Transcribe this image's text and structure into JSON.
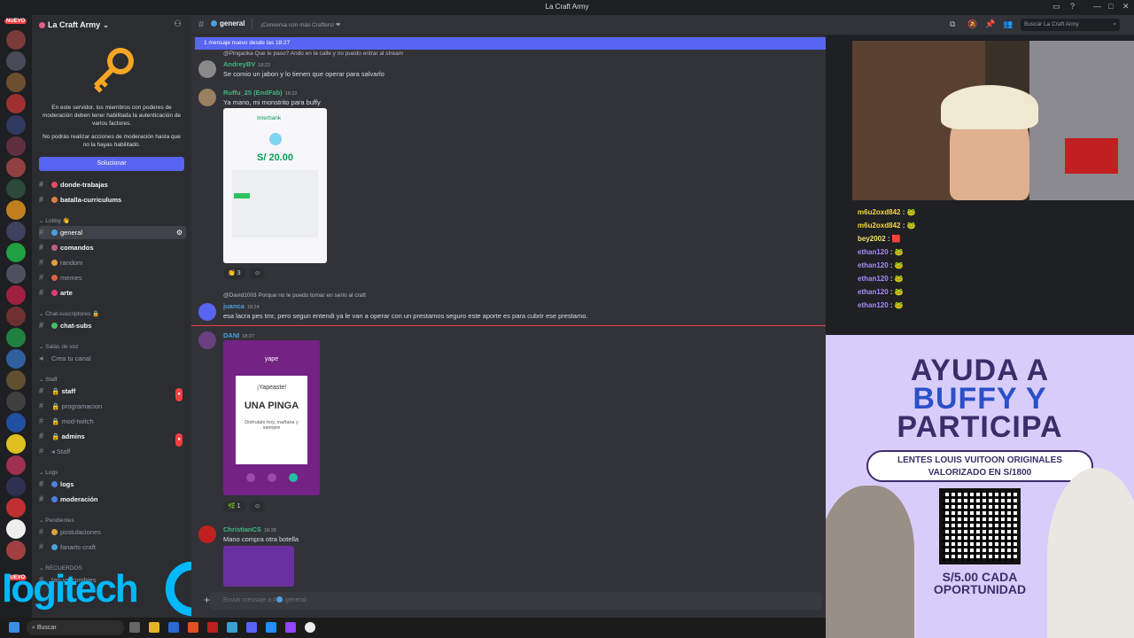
{
  "window": {
    "title": "La Craft Army"
  },
  "server": {
    "name": "La Craft Army"
  },
  "notice": {
    "line1": "En este servidor, los miembros con poderes de moderación deben tener habilitada la autenticación de varios factores.",
    "line2": "No podrás realizar acciones de moderación hasta que no la hayas habilitado.",
    "button": "Solucionar"
  },
  "server_badges": {
    "nuevo_top": "NUEVO",
    "nuevo_bottom": "NUEVO"
  },
  "channels": {
    "top": [
      {
        "name": "donde-trabajas"
      },
      {
        "name": "batalla-curriculums"
      }
    ],
    "lobby_label": "Lobby",
    "lobby": [
      {
        "name": "general"
      },
      {
        "name": "comandos"
      },
      {
        "name": "random"
      },
      {
        "name": "memes"
      },
      {
        "name": "arte"
      }
    ],
    "subs_label": "Chat-suscriptores",
    "subs": [
      {
        "name": "chat-subs"
      }
    ],
    "voice_label": "Salas de voz",
    "voice": [
      {
        "name": "Crea tu canal"
      }
    ],
    "staff_label": "Staff",
    "staff": [
      {
        "name": "staff"
      },
      {
        "name": "programacion"
      },
      {
        "name": "mod-twitch"
      },
      {
        "name": "admins"
      },
      {
        "name": "Staff"
      }
    ],
    "logs_label": "Logs",
    "logs": [
      {
        "name": "logs"
      },
      {
        "name": "moderación"
      }
    ],
    "pend_label": "Pendientes",
    "pend": [
      {
        "name": "postulaciones"
      },
      {
        "name": "fanarts-craft"
      }
    ],
    "rec_label": "RECUERDOS",
    "rec": [
      {
        "name": "tas-vs-zombies"
      }
    ]
  },
  "header": {
    "channel": "general",
    "topic": "¡Conversa con más Crafters! ❤",
    "search_placeholder": "Buscar La Craft Army"
  },
  "new_messages_bar": "1 mensaje nuevo desde las 18:27",
  "messages": [
    {
      "reply": "@Pingaoka Que le paso? Ando en la calle y no puedo entrar al stream"
    },
    {
      "user": "AndreyBV",
      "time": "18:22",
      "text": "Se comio un jabon y lo tienen que operar para salvarlo"
    },
    {
      "user": "Ruffu_25 (EndFab)",
      "time": "18:22",
      "text": "Ya mano, mi monstrito para buffy",
      "reaction": "3"
    },
    {
      "reply": "@David1003 Porque no le puedo tomar en serio al craft"
    },
    {
      "user": "juanca",
      "time": "18:24",
      "text": "esa lacra pes tmr, pero segun entendi ya le van a operar con un prestamos seguro este aporte es para cubrir ese prestamo."
    },
    {
      "user": "DANI",
      "time": "18:27",
      "reaction": "1"
    },
    {
      "user": "ChristianCS",
      "time": "18:28",
      "text": "Mano compra otra botella"
    }
  ],
  "interbank": {
    "brand": "Interbank",
    "amount": "S/ 20.00"
  },
  "yape": {
    "brand": "yape",
    "title": "¡Yapeaste!",
    "name": "UNA PINGA",
    "sub": "Disfrutalo hoy, mañana y siempre"
  },
  "composer": {
    "placeholder": "Enviar mensaje a #",
    "channel": "general"
  },
  "chat": [
    {
      "user": "m6u2oxd842",
      "color": "#f5d742"
    },
    {
      "user": "m6u2oxd842",
      "color": "#f5d742"
    },
    {
      "user": "bey2002",
      "color": "#f5e66b"
    },
    {
      "user": "ethan120",
      "color": "#a78bfa"
    },
    {
      "user": "ethan120",
      "color": "#a78bfa"
    },
    {
      "user": "ethan120",
      "color": "#a78bfa"
    },
    {
      "user": "ethan120",
      "color": "#a78bfa"
    },
    {
      "user": "ethan120",
      "color": "#a78bfa"
    }
  ],
  "promo": {
    "line1": "AYUDA A",
    "line2": "BUFFY Y",
    "line3": "PARTICIPA",
    "prize1": "LENTES LOUIS VUITOON ORIGINALES",
    "prize2": "VALORIZADO EN S/1800",
    "footer1": "S/5.00 CADA",
    "footer2": "OPORTUNIDAD"
  },
  "overlay": {
    "brand": "logitech"
  },
  "taskbar": {
    "search": "Buscar"
  }
}
